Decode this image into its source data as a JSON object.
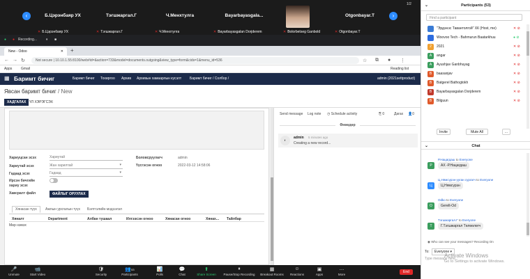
{
  "gallery": {
    "tiles": [
      {
        "big": "Б.Цэрэнбаяр УХ",
        "small": "Б.Цэрэнбаяр УХ"
      },
      {
        "big": "Тэгшжаргал.Г",
        "small": "Тэгшжаргал.Г"
      },
      {
        "big": "Ч.Менхтулга",
        "small": "Ч.Менхтулга"
      },
      {
        "big": "Bayarbayasgala...",
        "small": "Bayarbayasgalan Dorjderem"
      },
      {
        "big": "",
        "small": "Bolorbetseg Ganbold"
      },
      {
        "big": "Otgonbayar.T",
        "small": "Otgonbayar.T"
      }
    ],
    "page_label": "1/2"
  },
  "recording": {
    "status": "Recording...",
    "pause": "⏸",
    "stop": "■"
  },
  "browser": {
    "tab_title": "New - Odoo",
    "url_prefix": "Not secure",
    "url": "10.10.1.55:8100/web#id=&action=733&model=documents.outgoing&view_type=form&cids=1&menu_id=536",
    "bookmarks": [
      "Apps",
      "Gmail"
    ],
    "reading_list": "Reading list"
  },
  "odoo": {
    "brand": "Баримт бичиг",
    "menu": [
      "Баримт бичиг",
      "Тохиргоо",
      "Архив",
      "Архивын хамаарлын кусэлт",
      "Баримт бичиг / Солбор /"
    ],
    "user": "admin (2021settproduct)",
    "breadcrumb_root": "Явсан баримт бичиг",
    "breadcrumb_current": "New",
    "save_label": "ХАДГАЛАХ",
    "discard_label": "ҮЛ ХЭРЭГСЭХ",
    "fields": [
      {
        "label": "Хариуцсан эсэх",
        "value": "Хариутай"
      },
      {
        "label": "Хариутай эсэх",
        "value": "Жан харилтай"
      },
      {
        "label": "Гадаад эсэх",
        "value": "Гадаад"
      }
    ],
    "toggle_label": "Ирсэн бичгийн хариу эсэх",
    "file_label": "Хавсралт файл",
    "upload_label": "ФАЙЛЫГ ОРУУЛАХ",
    "right_fields": [
      {
        "label": "Боловсруулагч",
        "value": "admin"
      },
      {
        "label": "Үүсгэсэн огноо",
        "value": "2022-03-12 14:58:06"
      }
    ],
    "tabs": [
      "Хянасан түүх",
      "Ажлын урсгалын түүх",
      "Бэлтгэлийн мэдээлэл"
    ],
    "table_headers": [
      "Хяналт",
      "Department",
      "Албан тушаал",
      "Илгээсэн огноо",
      "Хянасан огноо",
      "Хянах...",
      "Тайлбар"
    ],
    "empty_row": "Мөр нэмэх"
  },
  "chatter": {
    "send_message": "Send message",
    "log_note": "Log note",
    "schedule": "Schedule activity",
    "followers": "0",
    "docs": "Дагах",
    "date_label": "Өнөөдөр",
    "author": "admin",
    "time": "5 minutes ago",
    "body": "Creating a new record..."
  },
  "zoombar": {
    "buttons": [
      {
        "label": "Unmute",
        "icon": "🎤"
      },
      {
        "label": "Start Video",
        "icon": "📹"
      },
      {
        "label": "Security",
        "icon": "🛡"
      },
      {
        "label": "Participants",
        "icon": "👥"
      },
      {
        "label": "Polls",
        "icon": "📊"
      },
      {
        "label": "Chat",
        "icon": "💬"
      },
      {
        "label": "Share Screen",
        "icon": "⬆"
      },
      {
        "label": "Pause/Stop Recording",
        "icon": "⏸"
      },
      {
        "label": "Breakout Rooms",
        "icon": "▦"
      },
      {
        "label": "Reactions",
        "icon": "☺"
      },
      {
        "label": "Apps",
        "icon": "▣"
      },
      {
        "label": "More",
        "icon": "…"
      }
    ],
    "participant_count": "53",
    "end_label": "End"
  },
  "sidepanel": {
    "title": "Participants (53)",
    "search_placeholder": "Find a participant",
    "participants": [
      {
        "name": "\"Эрдэнэс Тавантолгой\" ХК (Host, me)",
        "initial": "",
        "color": "#3a7bd5"
      },
      {
        "name": "Woovoo Tech - Bahmurun Baatarkhuu",
        "initial": "",
        "color": "#2d6cdf"
      },
      {
        "name": "2021",
        "initial": "2",
        "color": "#f0a030"
      },
      {
        "name": "angar",
        "initial": "A",
        "color": "#3a9d5d"
      },
      {
        "name": "Ayushjav Ganbhuyag",
        "initial": "A",
        "color": "#3a9d5d"
      },
      {
        "name": "baasanjav",
        "initial": "B",
        "color": "#e05a2b"
      },
      {
        "name": "Batgerel Bathogtokh",
        "initial": "B",
        "color": "#e05a2b"
      },
      {
        "name": "Bayarbayasgalan Dorjderem",
        "initial": "B",
        "color": "#c0392b"
      },
      {
        "name": "Bilguun",
        "initial": "B",
        "color": "#e05a2b"
      }
    ],
    "invite_label": "Invite",
    "mute_all_label": "Mute All",
    "more_label": "...",
    "chat_title": "Chat",
    "chat_messages": [
      {
        "from": "Р.Нацагдаш",
        "to": "Everyone",
        "text": "АХ -Р.Нацагдаш",
        "initial": "P",
        "color": "#3a9d5d"
      },
      {
        "from": "Ц.Нямсүрэн-ууган сургагч",
        "to": "Everyone",
        "text": "Ц.Нямсүрэн",
        "initial": "Ц",
        "color": "#2d8cff"
      },
      {
        "from": "Odko",
        "to": "Everyone",
        "text": "Gerelt-Od",
        "initial": "O",
        "color": "#3a9d5d"
      },
      {
        "from": "Тэгшжаргал.Г",
        "to": "Everyone",
        "text": "Г.Тэгшжаргал Төлөөлөгч",
        "initial": "T",
        "color": "#3a9d5d"
      }
    ],
    "who_can_see": "Who can see your messages? Recording On",
    "to_label": "To:",
    "to_value": "Everyone",
    "input_placeholder": "Type message here...",
    "to_word": "to"
  },
  "watermark": {
    "line1": "Activate Windows",
    "line2": "Go to Settings to activate Windows."
  }
}
